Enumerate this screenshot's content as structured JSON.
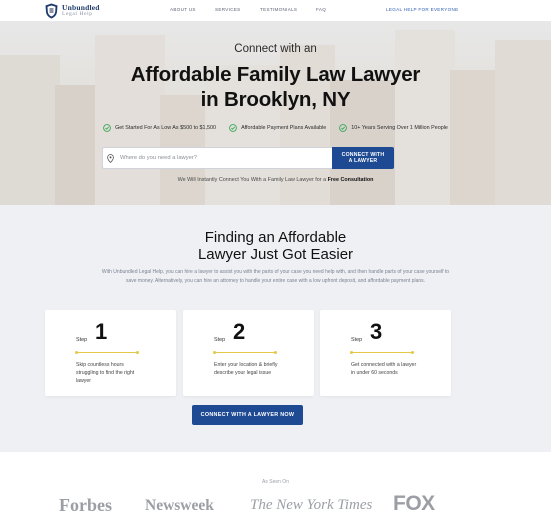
{
  "nav": {
    "logo_line1": "Unbundled",
    "logo_line2": "Legal Help",
    "links": [
      "About Us",
      "Services",
      "Testimonials",
      "FAQ"
    ],
    "cta": "Legal Help for Everyone"
  },
  "hero": {
    "connect": "Connect with an",
    "title_line1": "Affordable Family Law Lawyer",
    "title_line2": "in Brooklyn, NY",
    "benefits": [
      "Get Started For As Low As $500 to $1,500",
      "Affordable Payment Plans Available",
      "10+ Years Serving Over 1 Million People"
    ],
    "search_placeholder": "Where do you need a lawyer?",
    "search_button_line1": "CONNECT WITH",
    "search_button_line2": "A LAWYER",
    "free_text": "We Will Instantly Connect You With a Family Law Lawyer for a ",
    "free_bold": "Free Consultation"
  },
  "steps_section": {
    "title_line1": "Finding an Affordable",
    "title_line2": "Lawyer Just Got Easier",
    "description": "With Unbundled Legal Help, you can hire a lawyer to assist you with the parts of your case you need help with, and then handle parts of your case yourself to save money. Alternatively, you can hire an attorney to handle your entire case with a low upfront deposit, and affordable payment plans.",
    "step_word": "Step",
    "steps": [
      {
        "number": "1",
        "text": "Skip countless hours struggling to find the right lawyer"
      },
      {
        "number": "2",
        "text": "Enter your location & briefly describe your legal issue"
      },
      {
        "number": "3",
        "text": "Get connected with a lawyer in under 60 seconds"
      }
    ],
    "button": "CONNECT WITH A LAWYER NOW"
  },
  "as_seen_on": {
    "label": "As Seen On",
    "brands": [
      "Forbes",
      "Newsweek",
      "The New York Times",
      "FOX"
    ]
  },
  "colors": {
    "primary": "#1e4a94",
    "check": "#3aa85a",
    "accent_rule": "#e3c84a"
  }
}
